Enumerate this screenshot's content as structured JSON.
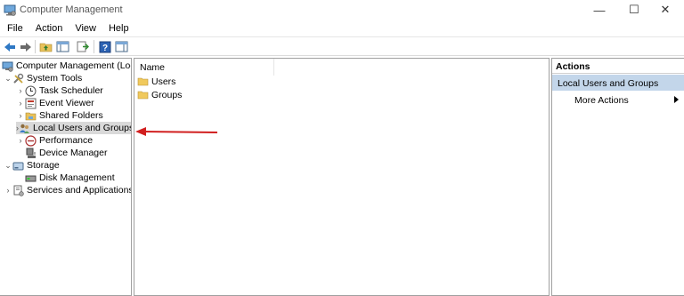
{
  "window": {
    "title": "Computer Management",
    "minimize": "—",
    "maximize": "☐",
    "close": "✕"
  },
  "menu": [
    "File",
    "Action",
    "View",
    "Help"
  ],
  "toolbar": {
    "buttons": [
      "back-icon",
      "forward-icon",
      "up-folder-icon",
      "show-hide-tree-icon",
      "export-list-icon",
      "help-icon",
      "action-pane-icon"
    ]
  },
  "tree": {
    "root": "Computer Management (Local",
    "system_tools": "System Tools",
    "task_scheduler": "Task Scheduler",
    "event_viewer": "Event Viewer",
    "shared_folders": "Shared Folders",
    "local_users": "Local Users and Groups",
    "performance": "Performance",
    "device_manager": "Device Manager",
    "storage": "Storage",
    "disk_management": "Disk Management",
    "services": "Services and Applications"
  },
  "list": {
    "column_name": "Name",
    "items": [
      "Users",
      "Groups"
    ]
  },
  "actions": {
    "header": "Actions",
    "section": "Local Users and Groups",
    "more": "More Actions"
  },
  "colors": {
    "selection": "#d9d9d9",
    "action_section": "#c3d6ea",
    "annotation_arrow": "#d11f1f"
  }
}
